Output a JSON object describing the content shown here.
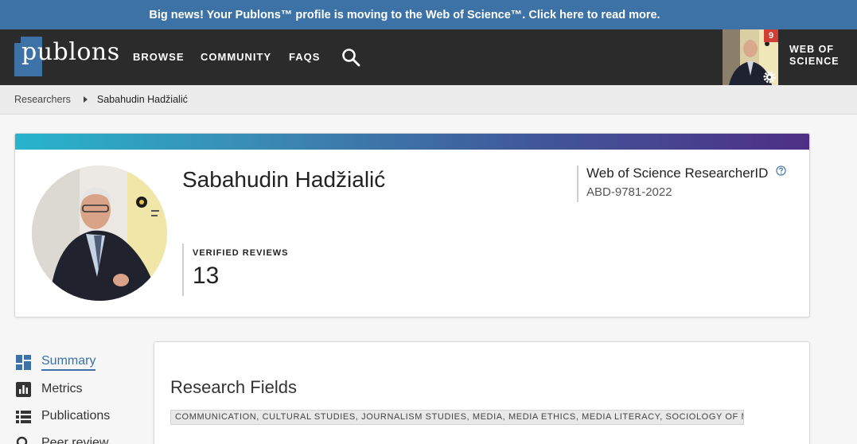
{
  "banner": {
    "text": "Big news! Your Publons™ profile is moving to the Web of Science™. Click here to read more."
  },
  "nav": {
    "logo_text": "publons",
    "links": [
      "BROWSE",
      "COMMUNITY",
      "FAQS"
    ],
    "notification_count": "9",
    "wos_line1": "WEB OF",
    "wos_line2": "SCIENCE"
  },
  "breadcrumb": {
    "parent": "Researchers",
    "current": "Sabahudin Hadžialić"
  },
  "profile": {
    "name": "Sabahudin Hadžialić",
    "reviews_label": "VERIFIED REVIEWS",
    "reviews_count": "13",
    "rid_label": "Web of Science ResearcherID",
    "rid_value": "ABD-9781-2022"
  },
  "sidebar": {
    "items": [
      {
        "label": "Summary",
        "icon": "dashboard-icon",
        "active": true
      },
      {
        "label": "Metrics",
        "icon": "bar-chart-icon",
        "active": false
      },
      {
        "label": "Publications",
        "icon": "list-icon",
        "active": false
      },
      {
        "label": "Peer review",
        "icon": "search-icon",
        "active": false
      }
    ]
  },
  "research": {
    "title": "Research Fields",
    "fields": "COMMUNICATION, CULTURAL STUDIES, JOURNALISM STUDIES, MEDIA, MEDIA ETHICS, MEDIA LITERACY, SOCIOLOGY OF MEDIA"
  },
  "colors": {
    "banner": "#3d72a7",
    "nav_bg": "#2b2b2b",
    "accent": "#3d72a7",
    "badge": "#d23e34"
  }
}
